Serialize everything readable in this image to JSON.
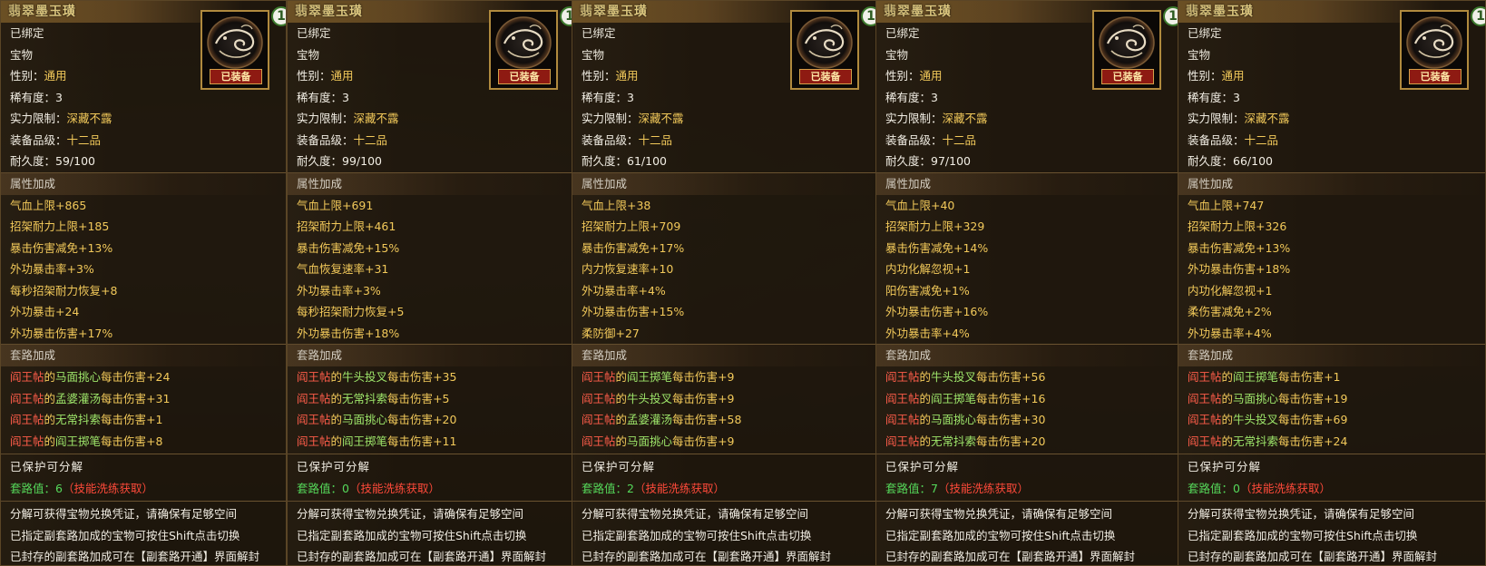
{
  "item_name": "翡翠墨玉璜",
  "equipped_tag": "已装备",
  "level_badge": "1",
  "labels": {
    "bound": "已绑定",
    "category": "宝物",
    "gender": "性别：",
    "rarity": "稀有度：",
    "strength_req": "实力限制：",
    "grade": "装备品级：",
    "durability": "耐久度："
  },
  "values": {
    "gender": "通用",
    "rarity": "3",
    "strength_req": "深藏不露",
    "grade": "十二品"
  },
  "section_titles": {
    "attributes": "属性加成",
    "routines": "套路加成"
  },
  "protect_text": "已保护可分解",
  "routine_value_label": "套路值：",
  "skill_hint": "（技能洗练获取）",
  "notes": [
    "分解可获得宝物兑换凭证，请确保有足够空间",
    "已指定副套路加成的宝物可按住Shift点击切换",
    "已封存的副套路加成可在【副套路开通】界面解封"
  ],
  "tooltips": [
    {
      "durability": "59/100",
      "routine_value": "6",
      "attributes": [
        "气血上限+865",
        "招架耐力上限+185",
        "暴击伤害减免+13%",
        "外功暴击率+3%",
        "每秒招架耐力恢复+8",
        "外功暴击+24",
        "外功暴击伤害+17%"
      ],
      "routines": [
        {
          "school": "阎王帖",
          "skill": "马面挑心",
          "effect": "每击伤害",
          "amount": "+24"
        },
        {
          "school": "阎王帖",
          "skill": "孟婆灌汤",
          "effect": "每击伤害",
          "amount": "+31"
        },
        {
          "school": "阎王帖",
          "skill": "无常抖索",
          "effect": "每击伤害",
          "amount": "+1"
        },
        {
          "school": "阎王帖",
          "skill": "阎王掷笔",
          "effect": "每击伤害",
          "amount": "+8"
        }
      ]
    },
    {
      "durability": "99/100",
      "routine_value": "0",
      "attributes": [
        "气血上限+691",
        "招架耐力上限+461",
        "暴击伤害减免+15%",
        "气血恢复速率+31",
        "外功暴击率+3%",
        "每秒招架耐力恢复+5",
        "外功暴击伤害+18%"
      ],
      "routines": [
        {
          "school": "阎王帖",
          "skill": "牛头投叉",
          "effect": "每击伤害",
          "amount": "+35"
        },
        {
          "school": "阎王帖",
          "skill": "无常抖索",
          "effect": "每击伤害",
          "amount": "+5"
        },
        {
          "school": "阎王帖",
          "skill": "马面挑心",
          "effect": "每击伤害",
          "amount": "+20"
        },
        {
          "school": "阎王帖",
          "skill": "阎王掷笔",
          "effect": "每击伤害",
          "amount": "+11"
        }
      ]
    },
    {
      "durability": "61/100",
      "routine_value": "2",
      "attributes": [
        "气血上限+38",
        "招架耐力上限+709",
        "暴击伤害减免+17%",
        "内力恢复速率+10",
        "外功暴击率+4%",
        "外功暴击伤害+15%",
        "柔防御+27"
      ],
      "routines": [
        {
          "school": "阎王帖",
          "skill": "阎王掷笔",
          "effect": "每击伤害",
          "amount": "+9"
        },
        {
          "school": "阎王帖",
          "skill": "牛头投叉",
          "effect": "每击伤害",
          "amount": "+9"
        },
        {
          "school": "阎王帖",
          "skill": "孟婆灌汤",
          "effect": "每击伤害",
          "amount": "+58"
        },
        {
          "school": "阎王帖",
          "skill": "马面挑心",
          "effect": "每击伤害",
          "amount": "+9"
        }
      ]
    },
    {
      "durability": "97/100",
      "routine_value": "7",
      "attributes": [
        "气血上限+40",
        "招架耐力上限+329",
        "暴击伤害减免+14%",
        "内功化解忽视+1",
        "阳伤害减免+1%",
        "外功暴击伤害+16%",
        "外功暴击率+4%"
      ],
      "routines": [
        {
          "school": "阎王帖",
          "skill": "牛头投叉",
          "effect": "每击伤害",
          "amount": "+56"
        },
        {
          "school": "阎王帖",
          "skill": "阎王掷笔",
          "effect": "每击伤害",
          "amount": "+16"
        },
        {
          "school": "阎王帖",
          "skill": "马面挑心",
          "effect": "每击伤害",
          "amount": "+30"
        },
        {
          "school": "阎王帖",
          "skill": "无常抖索",
          "effect": "每击伤害",
          "amount": "+20"
        }
      ]
    },
    {
      "durability": "66/100",
      "routine_value": "0",
      "attributes": [
        "气血上限+747",
        "招架耐力上限+326",
        "暴击伤害减免+13%",
        "外功暴击伤害+18%",
        "内功化解忽视+1",
        "柔伤害减免+2%",
        "外功暴击率+4%"
      ],
      "routines": [
        {
          "school": "阎王帖",
          "skill": "阎王掷笔",
          "effect": "每击伤害",
          "amount": "+1"
        },
        {
          "school": "阎王帖",
          "skill": "马面挑心",
          "effect": "每击伤害",
          "amount": "+19"
        },
        {
          "school": "阎王帖",
          "skill": "牛头投叉",
          "effect": "每击伤害",
          "amount": "+69"
        },
        {
          "school": "阎王帖",
          "skill": "无常抖索",
          "effect": "每击伤害",
          "amount": "+24"
        }
      ]
    }
  ],
  "colors": {
    "title_gold": "#f3dc8c",
    "value_gold": "#f2c95a",
    "routine_red": "#ff5d4a",
    "routine_green": "#9fe76b",
    "equip_red": "#8e1a12"
  },
  "icons": [
    "jade-pendant-icon"
  ]
}
